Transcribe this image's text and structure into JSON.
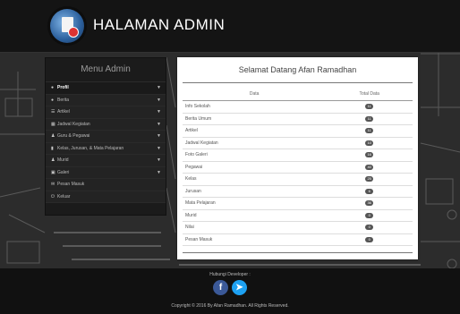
{
  "header": {
    "title": "HALAMAN ADMIN",
    "logo_icon": "admin-report-icon"
  },
  "sidebar": {
    "title": "Menu Admin",
    "items": [
      {
        "label": "Profil",
        "icon": "user-icon",
        "glyph": "●",
        "chevron": true
      },
      {
        "label": "Berita",
        "icon": "globe-icon",
        "glyph": "●",
        "chevron": true
      },
      {
        "label": "Artikel",
        "icon": "list-icon",
        "glyph": "☰",
        "chevron": true
      },
      {
        "label": "Jadwal Kegiatan",
        "icon": "calendar-icon",
        "glyph": "▦",
        "chevron": true
      },
      {
        "label": "Guru & Pegawai",
        "icon": "users-icon",
        "glyph": "♟",
        "chevron": true
      },
      {
        "label": "Kelas, Jurusan, & Mata Pelajaran",
        "icon": "book-icon",
        "glyph": "▮",
        "chevron": true
      },
      {
        "label": "Murid",
        "icon": "student-icon",
        "glyph": "♟",
        "chevron": true
      },
      {
        "label": "Galeri",
        "icon": "image-icon",
        "glyph": "▣",
        "chevron": true
      },
      {
        "label": "Pesan Masuk",
        "icon": "mail-icon",
        "glyph": "✉",
        "chevron": false
      },
      {
        "label": "Keluar",
        "icon": "power-icon",
        "glyph": "⏻",
        "chevron": false
      }
    ]
  },
  "main": {
    "welcome": "Selamat Datang Afan Ramadhan",
    "columns": [
      "Data",
      "Total Data"
    ],
    "rows": [
      {
        "label": "Info Sekolah",
        "value": "11"
      },
      {
        "label": "Berita Umum",
        "value": "11"
      },
      {
        "label": "Artikel",
        "value": "11"
      },
      {
        "label": "Jadwal Kegiatan",
        "value": "10"
      },
      {
        "label": "Foto Galeri",
        "value": "16"
      },
      {
        "label": "Pegawai",
        "value": "40"
      },
      {
        "label": "Kelas",
        "value": "25"
      },
      {
        "label": "Jurusan",
        "value": "6"
      },
      {
        "label": "Mata Pelajaran",
        "value": "36"
      },
      {
        "label": "Murid",
        "value": "0"
      },
      {
        "label": "Nilai",
        "value": "0"
      },
      {
        "label": "Pesan Masuk",
        "value": "0"
      }
    ]
  },
  "footer": {
    "contact_label": "Hubungi Developer :",
    "facebook_glyph": "f",
    "twitter_glyph": "➤",
    "copyright": "Copyright © 2016 By Afan Ramadhan. All Rights Reserved."
  }
}
